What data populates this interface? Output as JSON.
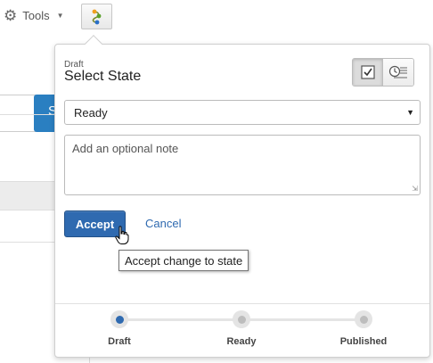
{
  "toolbar": {
    "tools_label": "Tools",
    "tools_icon": "gear-icon",
    "workflow_icon": "workflow-icon"
  },
  "background": {
    "button_label": "S"
  },
  "popover": {
    "current_state_label": "Draft",
    "title": "Select State",
    "view_toggle": [
      {
        "icon": "checklist-icon",
        "active": true
      },
      {
        "icon": "history-icon",
        "active": false
      }
    ],
    "state_select": {
      "value": "Ready"
    },
    "note": {
      "placeholder": "Add an optional note"
    },
    "accept_label": "Accept",
    "cancel_label": "Cancel",
    "tooltip": "Accept change to state",
    "steps": [
      {
        "label": "Draft",
        "current": true
      },
      {
        "label": "Ready",
        "current": false
      },
      {
        "label": "Published",
        "current": false
      }
    ]
  },
  "colors": {
    "accent": "#2f6ab0",
    "bg_button": "#2a7fc1"
  }
}
